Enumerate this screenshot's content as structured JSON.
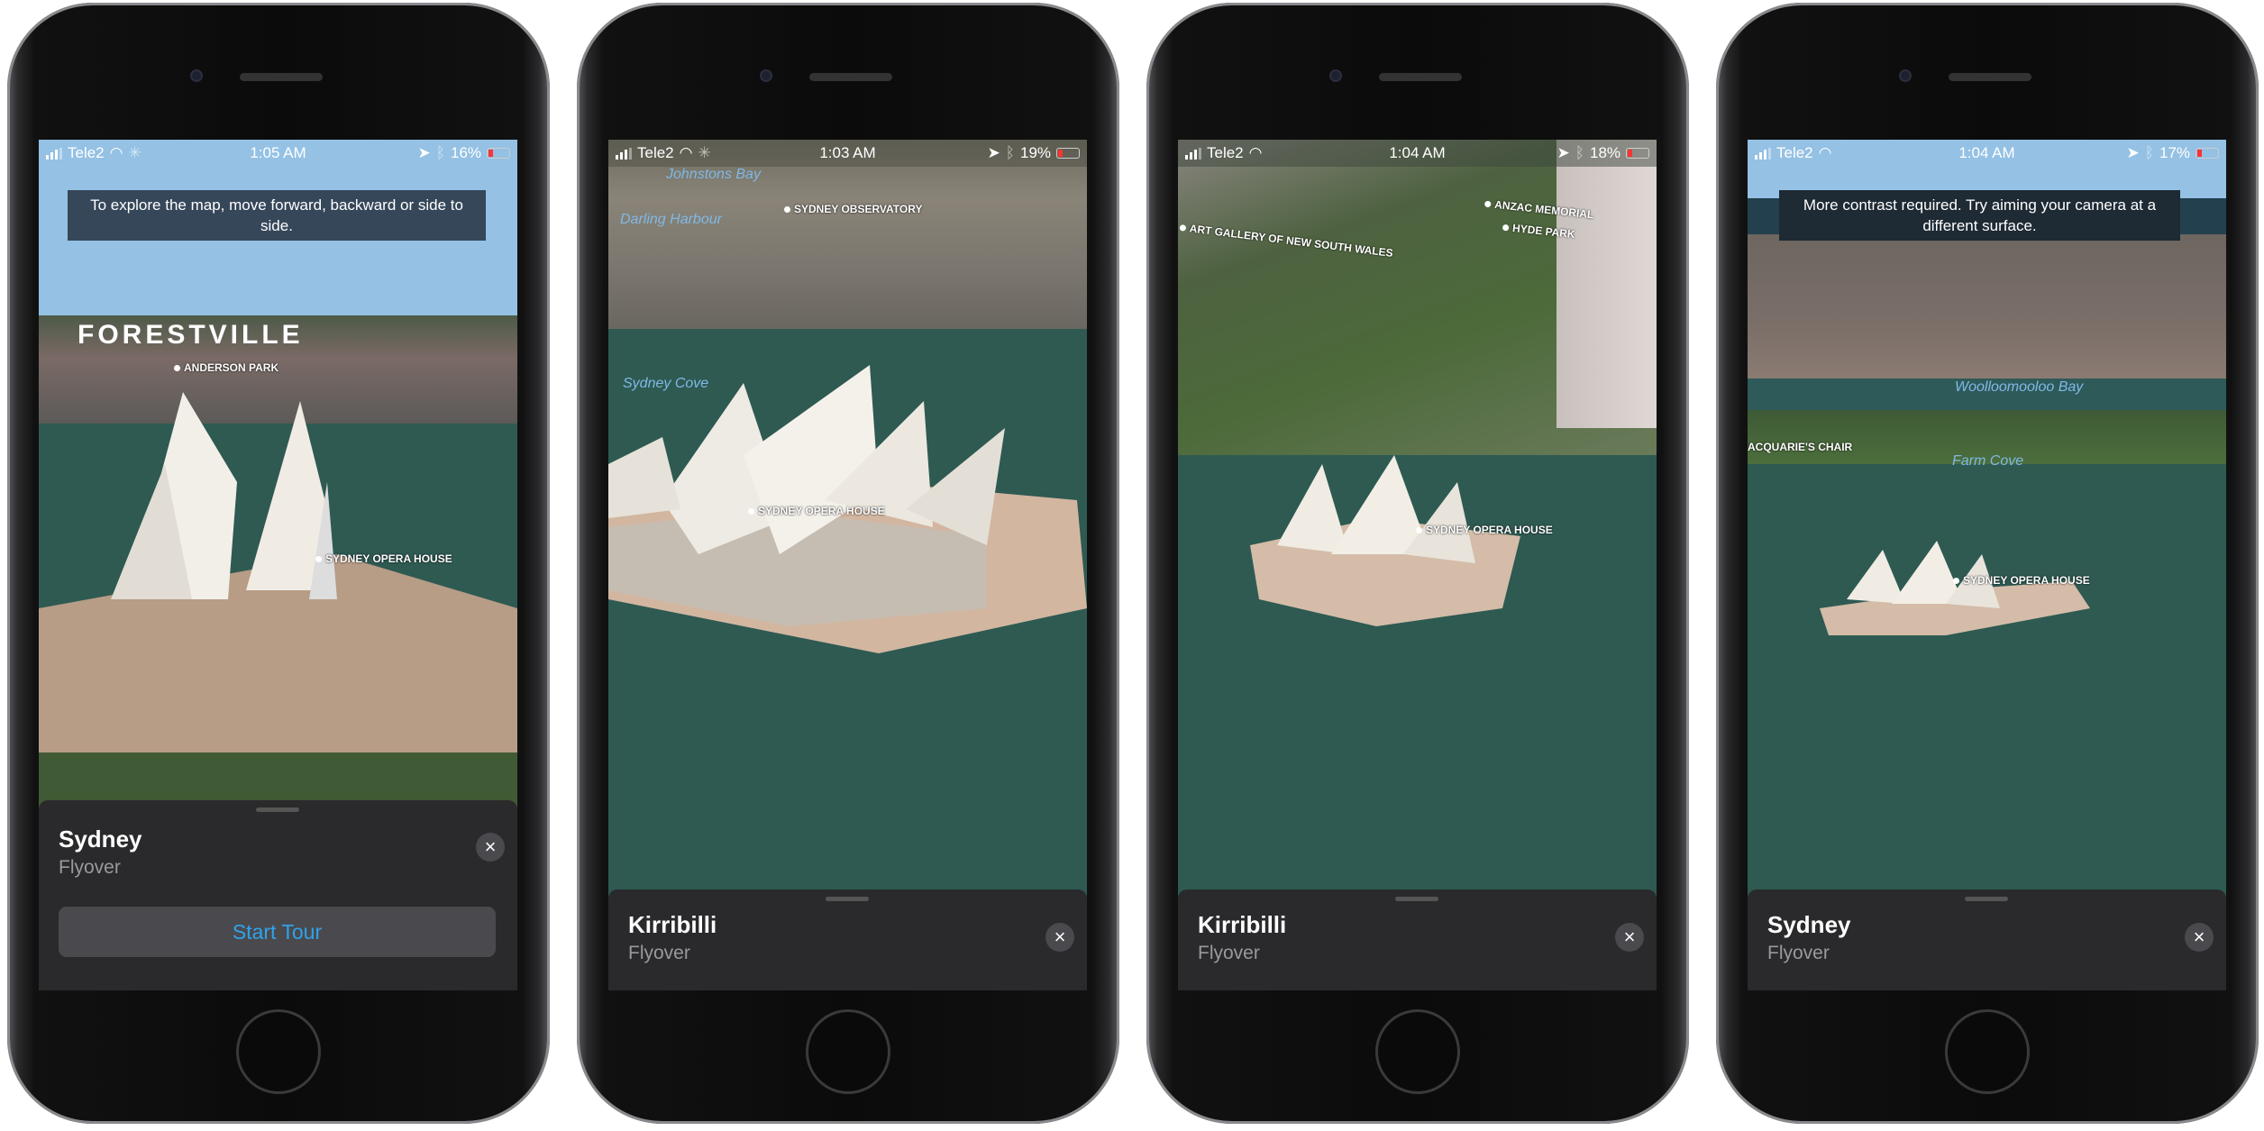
{
  "phones": [
    {
      "status": {
        "carrier": "Tele2",
        "time": "1:05 AM",
        "battery": "16%"
      },
      "toast": "To explore the map, move forward, backward or side to side.",
      "labels": {
        "area": "FORESTVILLE",
        "poi1": "ANDERSON PARK",
        "poi2": "SYDNEY OPERA HOUSE"
      },
      "sheet": {
        "title": "Sydney",
        "subtitle": "Flyover",
        "button": "Start Tour"
      }
    },
    {
      "status": {
        "carrier": "Tele2",
        "time": "1:03 AM",
        "battery": "19%"
      },
      "labels": {
        "water1": "Johnstons Bay",
        "water2": "Darling Harbour",
        "poi1": "SYDNEY OBSERVATORY",
        "water3": "Sydney Cove",
        "poi2": "SYDNEY OPERA HOUSE"
      },
      "sheet": {
        "title": "Kirribilli",
        "subtitle": "Flyover"
      }
    },
    {
      "status": {
        "carrier": "Tele2",
        "time": "1:04 AM",
        "battery": "18%"
      },
      "labels": {
        "poi1": "ART GALLERY OF NEW SOUTH WALES",
        "poi2": "ANZAC MEMORIAL",
        "poi3": "HYDE PARK",
        "poi4": "SYDNEY OPERA HOUSE"
      },
      "sheet": {
        "title": "Kirribilli",
        "subtitle": "Flyover"
      }
    },
    {
      "status": {
        "carrier": "Tele2",
        "time": "1:04 AM",
        "battery": "17%"
      },
      "toast": "More contrast required. Try aiming your camera at a different surface.",
      "labels": {
        "water1": "Woolloomooloo Bay",
        "poi1": "ACQUARIE'S CHAIR",
        "water2": "Farm Cove",
        "poi2": "SYDNEY OPERA HOUSE"
      },
      "sheet": {
        "title": "Sydney",
        "subtitle": "Flyover"
      }
    }
  ],
  "colors": {
    "accent": "#2ea3ea",
    "sheet": "#2a2a2c",
    "battery_low": "#ff3333"
  }
}
